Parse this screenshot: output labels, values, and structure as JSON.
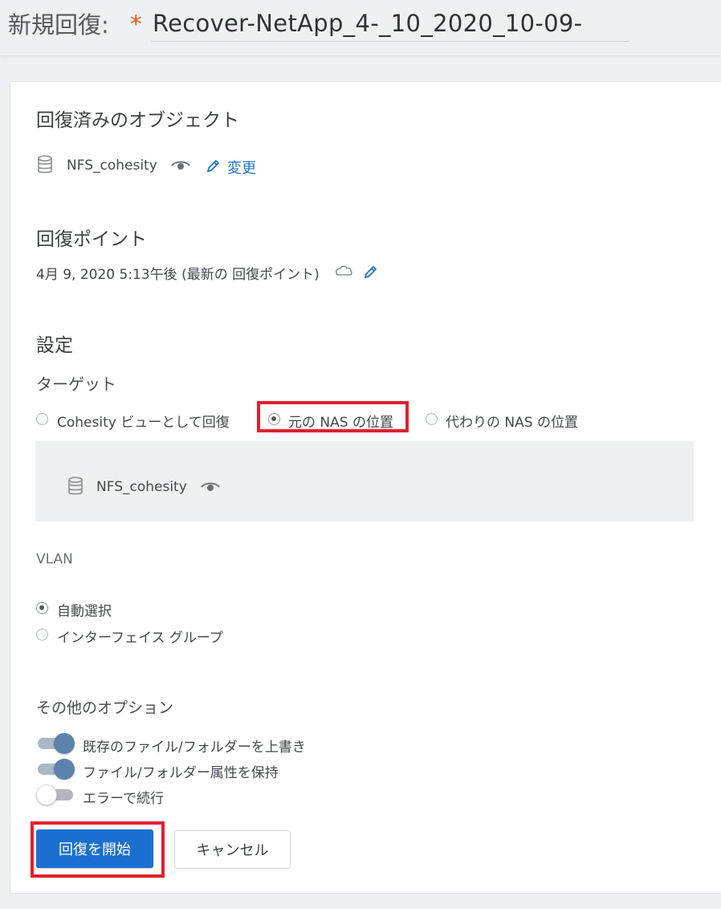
{
  "header": {
    "title": "新規回復:",
    "required_mark": "*",
    "name_value": "Recover-NetApp_4-_10_2020_10-09-"
  },
  "recovered_objects": {
    "title": "回復済みのオブジェクト",
    "object_name": "NFS_cohesity",
    "change_label": "変更"
  },
  "recovery_point": {
    "title": "回復ポイント",
    "value": "4月 9, 2020 5:13午後 (最新の 回復ポイント)"
  },
  "settings": {
    "title": "設定",
    "target_label": "ターゲット",
    "target_options": [
      {
        "label": "Cohesity ビューとして回復",
        "selected": false
      },
      {
        "label": "元の NAS の位置",
        "selected": true
      },
      {
        "label": "代わりの NAS の位置",
        "selected": false
      }
    ],
    "target_object": "NFS_cohesity"
  },
  "vlan": {
    "label": "VLAN",
    "options": [
      {
        "label": "自動選択",
        "selected": true
      },
      {
        "label": "インターフェイス グループ",
        "selected": false
      }
    ]
  },
  "other_options": {
    "title": "その他のオプション",
    "toggles": [
      {
        "label": "既存のファイル/フォルダーを上書き",
        "on": true
      },
      {
        "label": "ファイル/フォルダー属性を保持",
        "on": true
      },
      {
        "label": "エラーで続行",
        "on": false
      }
    ]
  },
  "actions": {
    "start_label": "回復を開始",
    "cancel_label": "キャンセル"
  },
  "colors": {
    "primary": "#1b6fd0",
    "link": "#2475c0",
    "required": "#e2561f",
    "highlight": "#e0202c",
    "toggle_on": "#5b83ad"
  }
}
